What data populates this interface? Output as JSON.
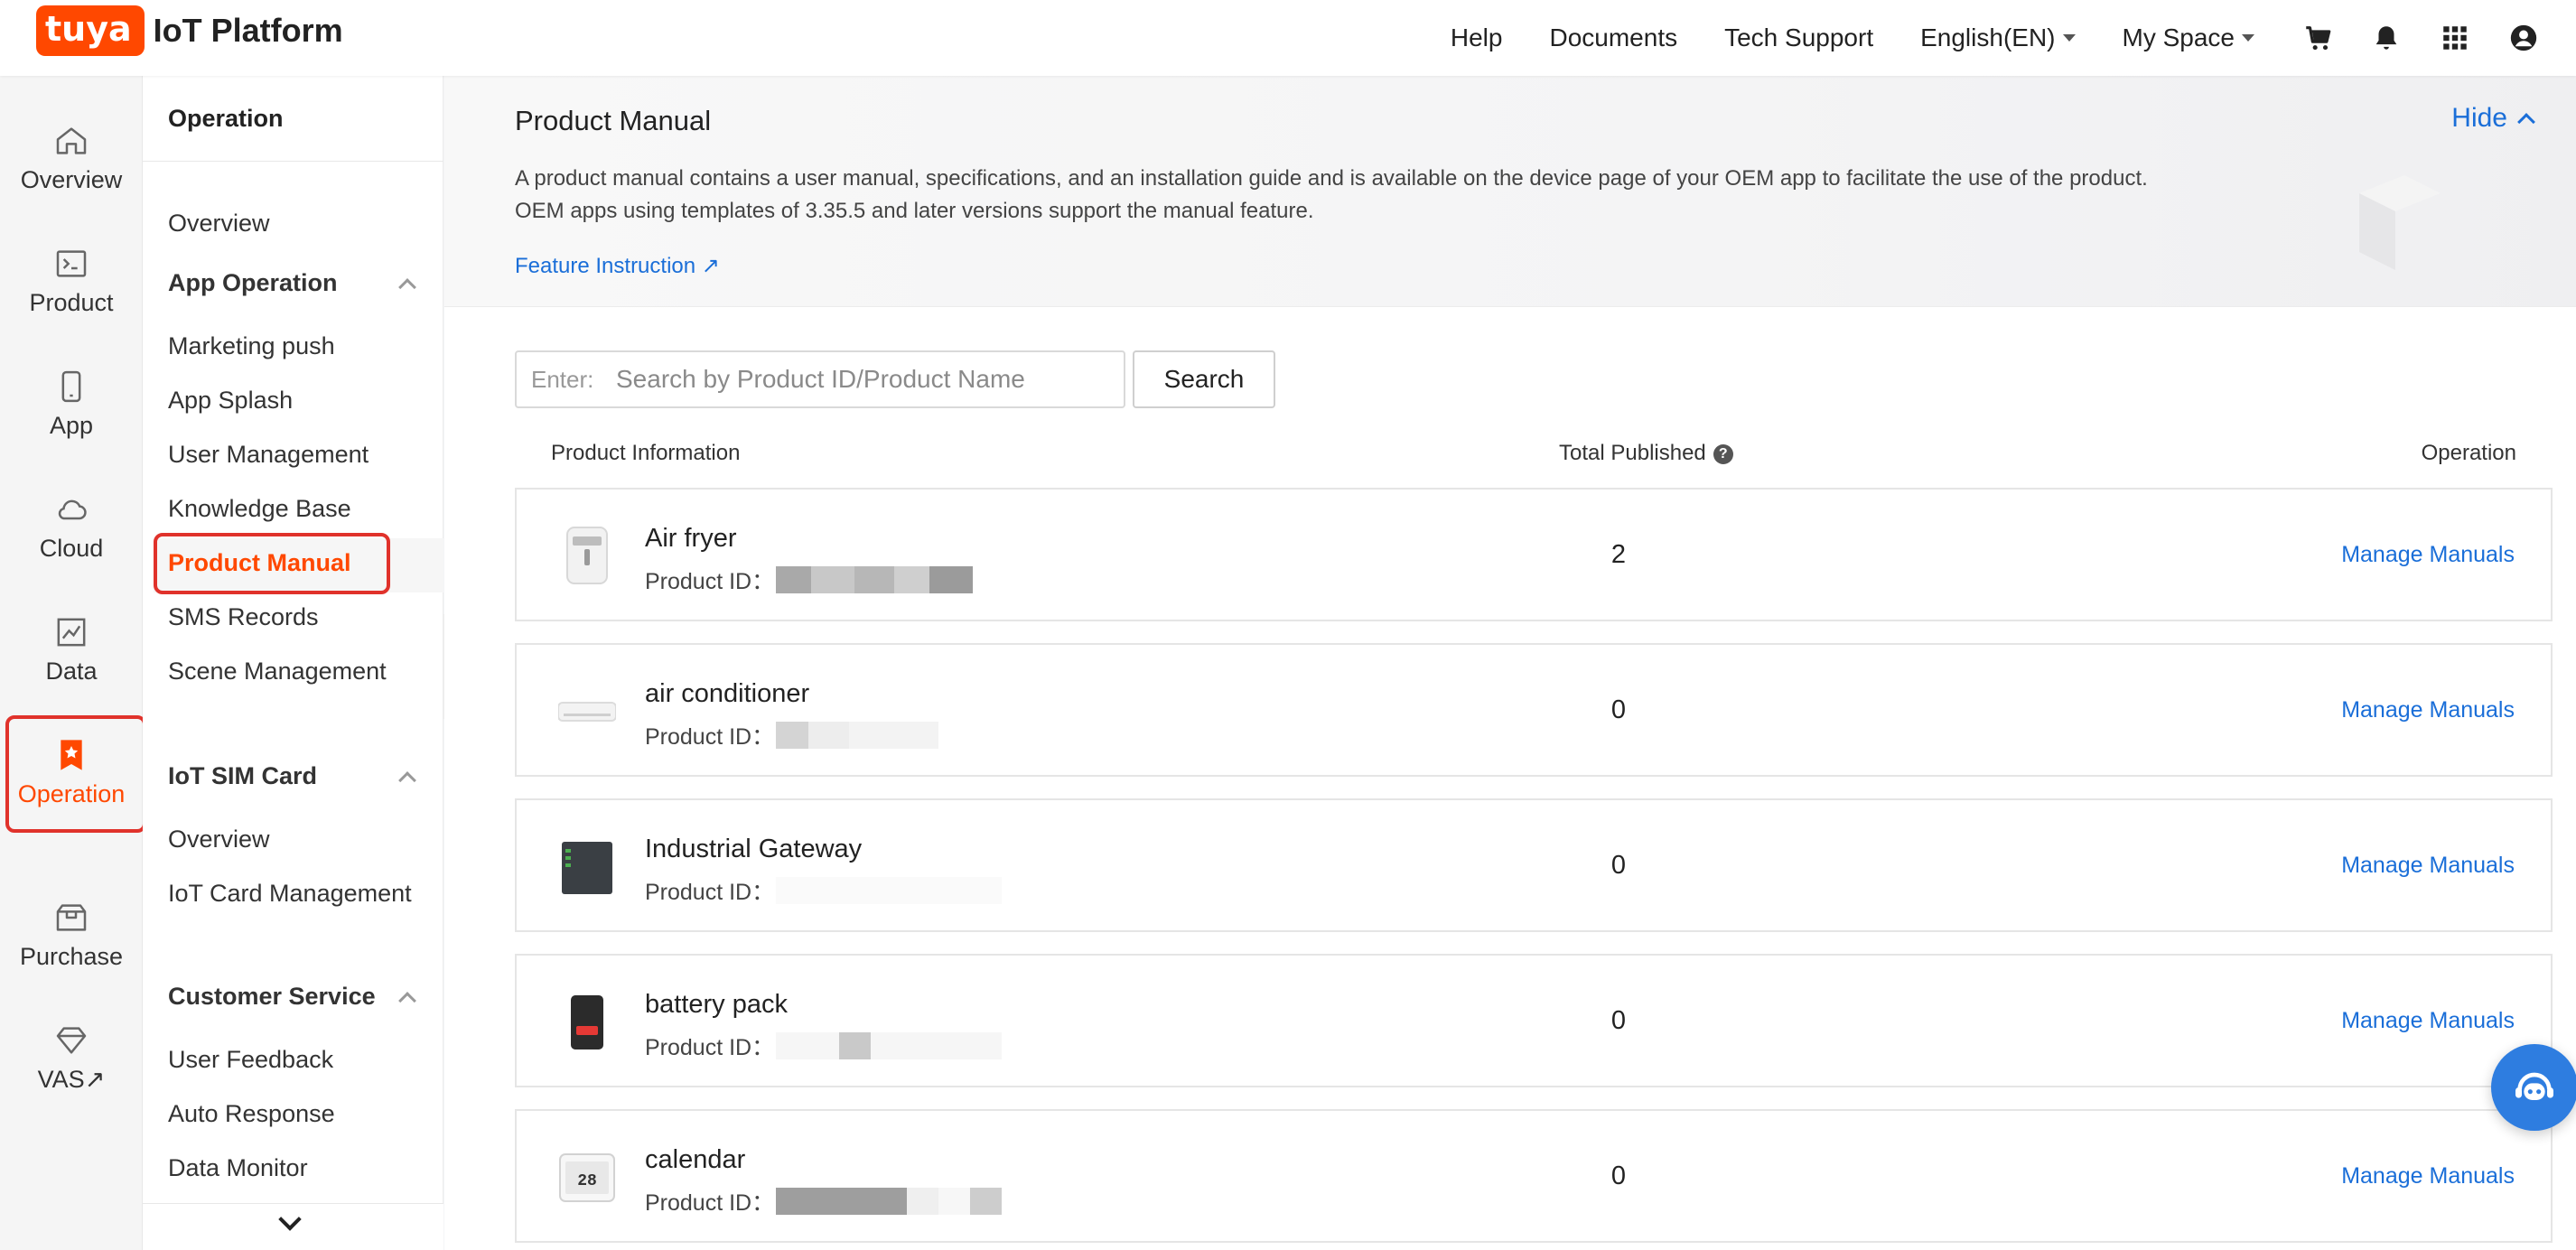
{
  "header": {
    "logo_badge": "tuya",
    "logo_text": "IoT Platform",
    "nav": [
      "Help",
      "Documents",
      "Tech Support"
    ],
    "language": "English(EN)",
    "space": "My Space",
    "icons": [
      "cart-icon",
      "bell-icon",
      "apps-grid-icon",
      "account-icon"
    ]
  },
  "rail": {
    "items": [
      {
        "label": "Overview",
        "icon": "home-icon"
      },
      {
        "label": "Product",
        "icon": "terminal-icon"
      },
      {
        "label": "App",
        "icon": "phone-icon"
      },
      {
        "label": "Cloud",
        "icon": "cloud-icon"
      },
      {
        "label": "Data",
        "icon": "chart-icon"
      },
      {
        "label": "Operation",
        "icon": "bookmark-star-icon"
      },
      {
        "label": "Purchase",
        "icon": "box-icon"
      },
      {
        "label": "VAS",
        "icon": "diamond-icon",
        "suffix": "↗"
      }
    ],
    "active": "Operation"
  },
  "sidebar": {
    "title": "Operation",
    "overview": "Overview",
    "app_operation": {
      "label": "App Operation",
      "items": [
        "Marketing push",
        "App Splash",
        "User Management",
        "Knowledge Base",
        "Product Manual",
        "SMS Records",
        "Scene Management"
      ]
    },
    "iot_sim": {
      "label": "IoT SIM Card",
      "items": [
        "Overview",
        "IoT Card Management"
      ]
    },
    "customer_service": {
      "label": "Customer Service",
      "items": [
        "User Feedback",
        "Auto Response",
        "Data Monitor"
      ]
    },
    "active": "Product Manual"
  },
  "banner": {
    "title": "Product Manual",
    "desc_line1": "A product manual contains a user manual, specifications, and an installation guide and is available on the device page of your OEM app to facilitate the use of the product.",
    "desc_line2": "OEM apps using templates of 3.35.5 and later versions support the manual feature.",
    "link": "Feature Instruction ↗",
    "hide": "Hide"
  },
  "search": {
    "prefix": "Enter:",
    "placeholder": "Search by Product ID/Product Name",
    "button": "Search"
  },
  "table": {
    "col_info": "Product Information",
    "col_total": "Total Published",
    "col_help": "?",
    "col_op": "Operation",
    "id_label": "Product ID：",
    "action": "Manage Manuals",
    "rows": [
      {
        "name": "Air fryer",
        "count": "2",
        "thumb": "air-fryer-thumbnail"
      },
      {
        "name": "air conditioner",
        "count": "0",
        "thumb": "air-conditioner-thumbnail"
      },
      {
        "name": "Industrial Gateway",
        "count": "0",
        "thumb": "gateway-thumbnail"
      },
      {
        "name": "battery pack",
        "count": "0",
        "thumb": "battery-pack-thumbnail"
      },
      {
        "name": "calendar",
        "count": "0",
        "thumb": "calendar-thumbnail",
        "thumb_text": "28"
      }
    ]
  },
  "colors": {
    "accent": "#ff4800",
    "link": "#1a6ed8",
    "highlight_border": "#e0322b"
  }
}
